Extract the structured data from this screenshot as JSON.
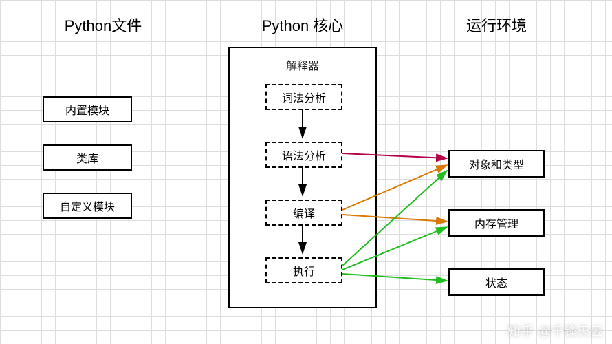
{
  "columns": {
    "files": {
      "title": "Python文件"
    },
    "core": {
      "title": "Python 核心"
    },
    "env": {
      "title": "运行环境"
    }
  },
  "files": {
    "builtin": "内置模块",
    "library": "类库",
    "custom": "自定义模块"
  },
  "interpreter": {
    "title": "解释器",
    "stages": {
      "lex": "词法分析",
      "parse": "语法分析",
      "compile": "编译",
      "execute": "执行"
    }
  },
  "env": {
    "objects_types": "对象和类型",
    "memory": "内存管理",
    "state": "状态"
  },
  "arrows": {
    "colors": {
      "black": "#000000",
      "red": "#b5004b",
      "orange": "#d87a00",
      "green": "#1fbd1f"
    }
  },
  "watermark": "知乎 @千锋天云"
}
